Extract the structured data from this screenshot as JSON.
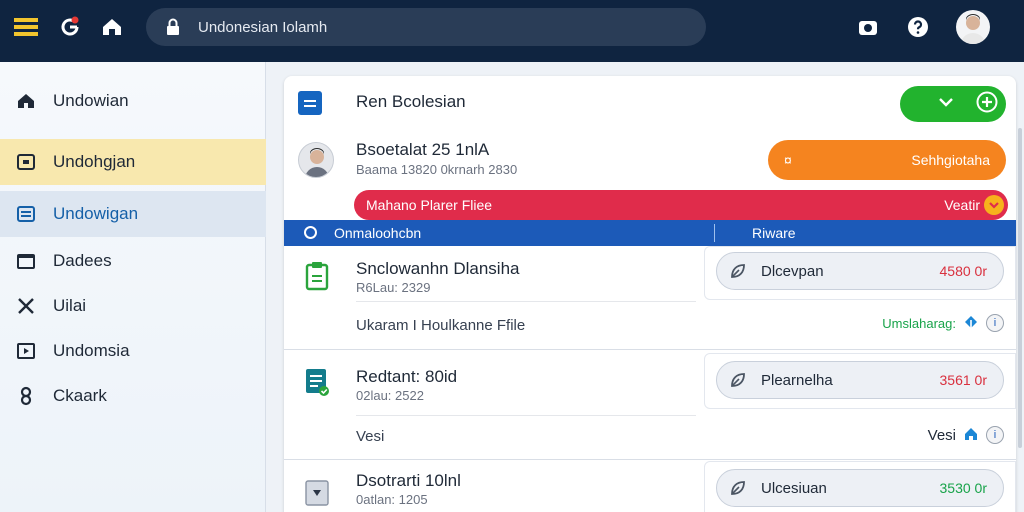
{
  "topbar": {
    "search_value": "Undonesian Iolamh",
    "icons": [
      "menu-icon",
      "google-icon",
      "home-icon",
      "lock-icon",
      "camera-icon",
      "help-icon",
      "avatar"
    ]
  },
  "sidebar": {
    "items": [
      {
        "label": "Undowian",
        "icon": "home-icon"
      },
      {
        "label": "Undohgjan",
        "icon": "square-icon"
      },
      {
        "label": "Undowigan",
        "icon": "list-icon"
      },
      {
        "label": "Dadees",
        "icon": "folder-icon"
      },
      {
        "label": "Uilai",
        "icon": "x-icon"
      },
      {
        "label": "Undomsia",
        "icon": "play-icon"
      },
      {
        "label": "Ckaark",
        "icon": "link-icon"
      }
    ]
  },
  "panel": {
    "title": "Ren Bcolesian",
    "profile": {
      "name": "Bsoetalat 25 1nlA",
      "sub": "Baama 13820 0krnarh 2830"
    },
    "orange_pill": {
      "left": "¤",
      "right": "Sehhgiotaha"
    },
    "red_pill": {
      "label": "Mahano Plarer Fliee",
      "tag": "Veatir"
    },
    "header": {
      "col1": "Onmaloohcbn",
      "col2": "Riware"
    },
    "rows": [
      {
        "title": "Snclowanhn Dlansiha",
        "sub": "R6Lau: 2329",
        "desc": "Ukaram I Houlkanne Ffile",
        "card": {
          "label": "Dlcevpan",
          "value": "4580 0r",
          "value_color": "#d9303e"
        },
        "meta": {
          "text": "Umslaharag:",
          "color": "#18a34a"
        }
      },
      {
        "title": "Redtant: 80id",
        "sub": "02lau: 2522",
        "desc": "Vesi",
        "card": {
          "label": "Plearnelha",
          "value": "3561 0r",
          "value_color": "#d9303e"
        },
        "meta": {
          "text": "Vesi",
          "color": "#1f2937"
        }
      },
      {
        "title": "Dsotrarti 10lnl",
        "sub": "0atlan: 1205",
        "card": {
          "label": "Ulcesiuan",
          "value": "3530 0r",
          "value_color": "#18a34a"
        }
      }
    ]
  },
  "colors": {
    "topbar": "#0f2440",
    "green": "#22b32e",
    "orange": "#f5841f",
    "red": "#e02c4b",
    "header_blue": "#1c5ab8"
  }
}
